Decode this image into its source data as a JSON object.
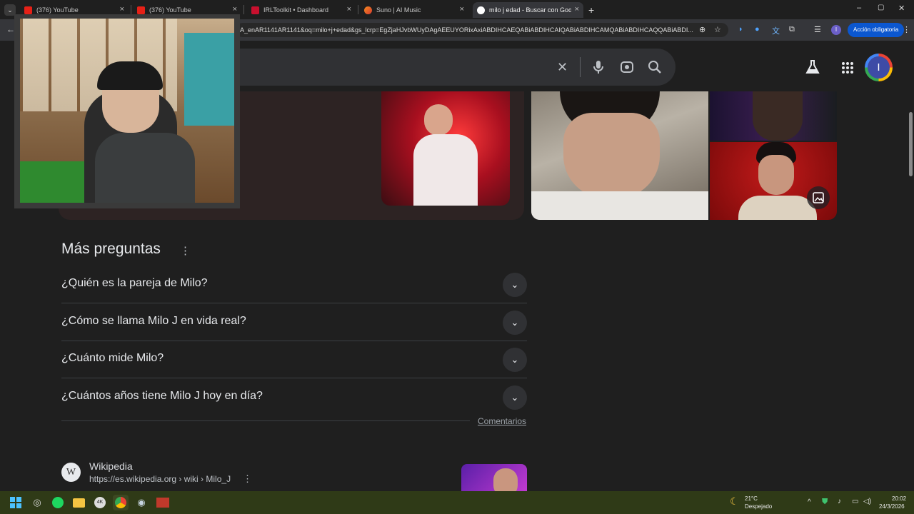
{
  "tabs": [
    {
      "title": "(376) YouTube",
      "close": "×"
    },
    {
      "title": "(376) YouTube",
      "close": "×"
    },
    {
      "title": "IRLToolkit • Dashboard",
      "close": "×"
    },
    {
      "title": "Suno | AI Music",
      "close": "×"
    },
    {
      "title": "milo j edad - Buscar con Google",
      "close": "×"
    }
  ],
  "new_tab": "+",
  "window_controls": {
    "minimize": "–",
    "maximize": "▢",
    "close": "✕"
  },
  "address_bar": {
    "url": "A_enAR1141AR1141&oq=milo+j+edad&gs_lcrp=EgZjaHJvbWUyDAgAEEUYORixAxiABDIHCAEQABiABDIHCAIQABiABDIHCAMQABiABDIHCAQQABiABDI..."
  },
  "toolbar": {
    "action_button": "Acción obligatoria",
    "profile_initial": "I",
    "back": "←"
  },
  "google": {
    "profile_initial": "I",
    "search_icons": {
      "clear": "✕",
      "mic": "mic-icon",
      "lens": "lens-icon",
      "search": "search-icon"
    }
  },
  "more_questions": {
    "title": "Más preguntas",
    "menu": "⋮",
    "questions": [
      "¿Quién es la pareja de Milo?",
      "¿Cómo se llama Milo J en vida real?",
      "¿Cuánto mide Milo?",
      "¿Cuántos años tiene Milo J hoy en día?"
    ],
    "feedback": "Comentarios"
  },
  "result": {
    "logo": "W",
    "site_name": "Wikipedia",
    "url": "https://es.wikipedia.org › wiki › Milo_J",
    "menu": "⋮"
  },
  "taskbar": {
    "weather_temp": "21°C",
    "weather_desc": "Despejado",
    "time": "20:02",
    "date": "24/3/2026",
    "tray_arrow": "^"
  },
  "colors": {
    "accent": "#0b57d0",
    "background": "#1f1f1f",
    "taskbar": "#2f3a17"
  }
}
